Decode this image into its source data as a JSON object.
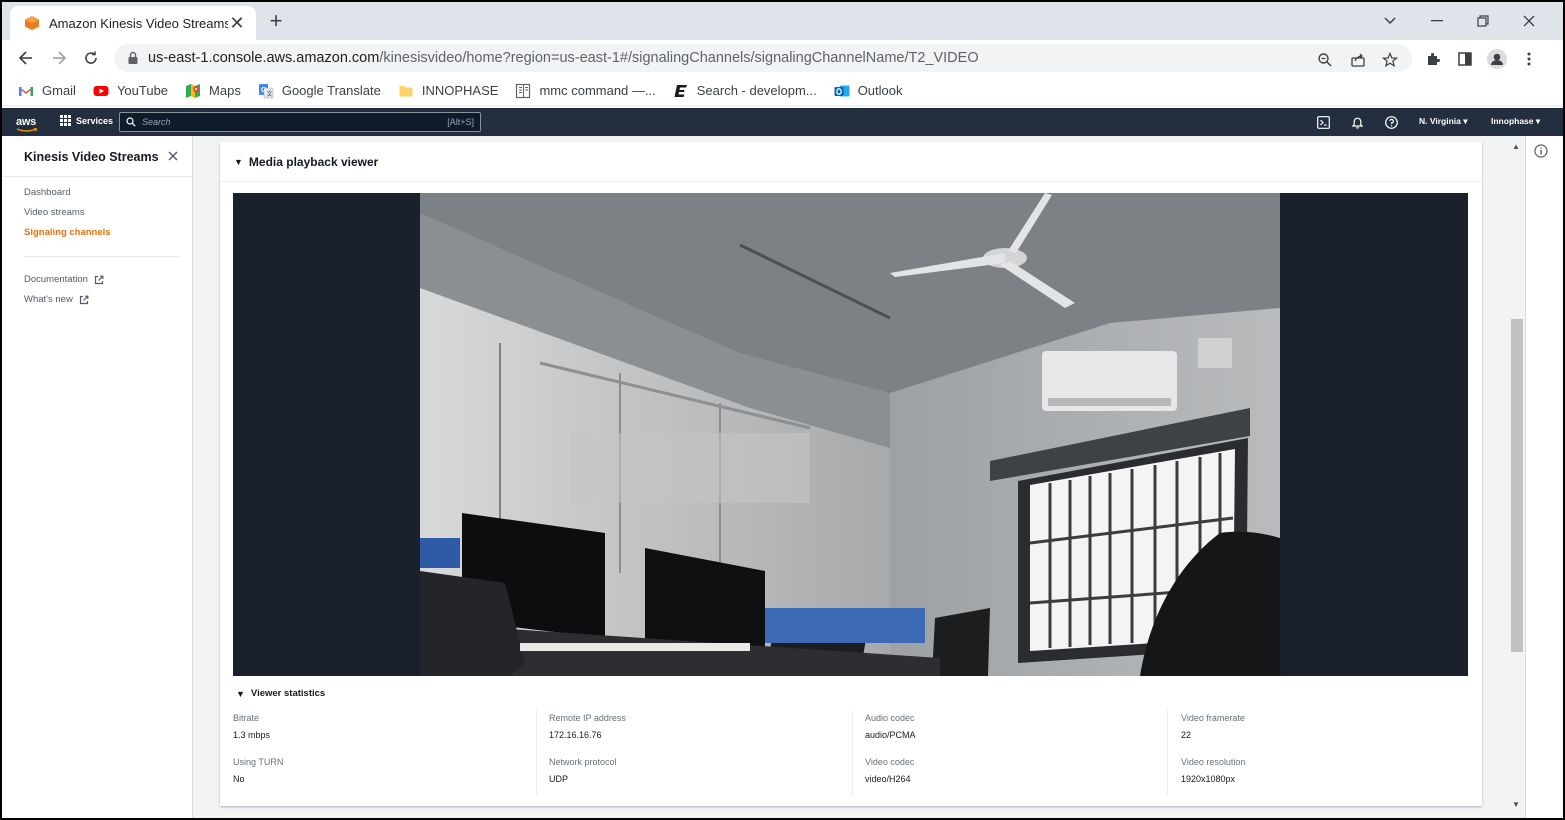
{
  "browser": {
    "tab_title": "Amazon Kinesis Video Streams",
    "url_host": "us-east-1.console.aws.amazon.com",
    "url_path": "/kinesisvideo/home?region=us-east-1#/signalingChannels/signalingChannelName/T2_VIDEO",
    "bookmarks": [
      {
        "label": "Gmail",
        "icon": "gmail-icon"
      },
      {
        "label": "YouTube",
        "icon": "youtube-icon"
      },
      {
        "label": "Maps",
        "icon": "maps-icon"
      },
      {
        "label": "Google Translate",
        "icon": "translate-icon"
      },
      {
        "label": "INNOPHASE",
        "icon": "folder-icon"
      },
      {
        "label": "mmc command —...",
        "icon": "doc-icon"
      },
      {
        "label": "Search - developm...",
        "icon": "e-logo-icon"
      },
      {
        "label": "Outlook",
        "icon": "outlook-icon"
      }
    ]
  },
  "aws_nav": {
    "logo": "aws",
    "services_label": "Services",
    "search_placeholder": "Search",
    "search_shortcut": "[Alt+S]",
    "region_label": "N. Virginia",
    "account_label": "Innophase"
  },
  "sidebar": {
    "title": "Kinesis Video Streams",
    "items": [
      {
        "label": "Dashboard",
        "active": false
      },
      {
        "label": "Video streams",
        "active": false
      },
      {
        "label": "Signaling channels",
        "active": true
      }
    ],
    "links": [
      {
        "label": "Documentation"
      },
      {
        "label": "What's new"
      }
    ]
  },
  "main": {
    "panel_title": "Media playback viewer",
    "stats_title": "Viewer statistics",
    "stats": [
      {
        "label": "Bitrate",
        "value": "1.3 mbps"
      },
      {
        "label": "Remote IP address",
        "value": "172.16.16.76"
      },
      {
        "label": "Audio codec",
        "value": "audio/PCMA"
      },
      {
        "label": "Video framerate",
        "value": "22"
      },
      {
        "label": "Using TURN",
        "value": "No"
      },
      {
        "label": "Network protocol",
        "value": "UDP"
      },
      {
        "label": "Video codec",
        "value": "video/H264"
      },
      {
        "label": "Video resolution",
        "value": "1920x1080px"
      }
    ]
  },
  "colors": {
    "aws_nav_bg": "#232f3e",
    "accent_orange": "#ec7211",
    "chrome_tabstrip": "#dfe3ea"
  }
}
